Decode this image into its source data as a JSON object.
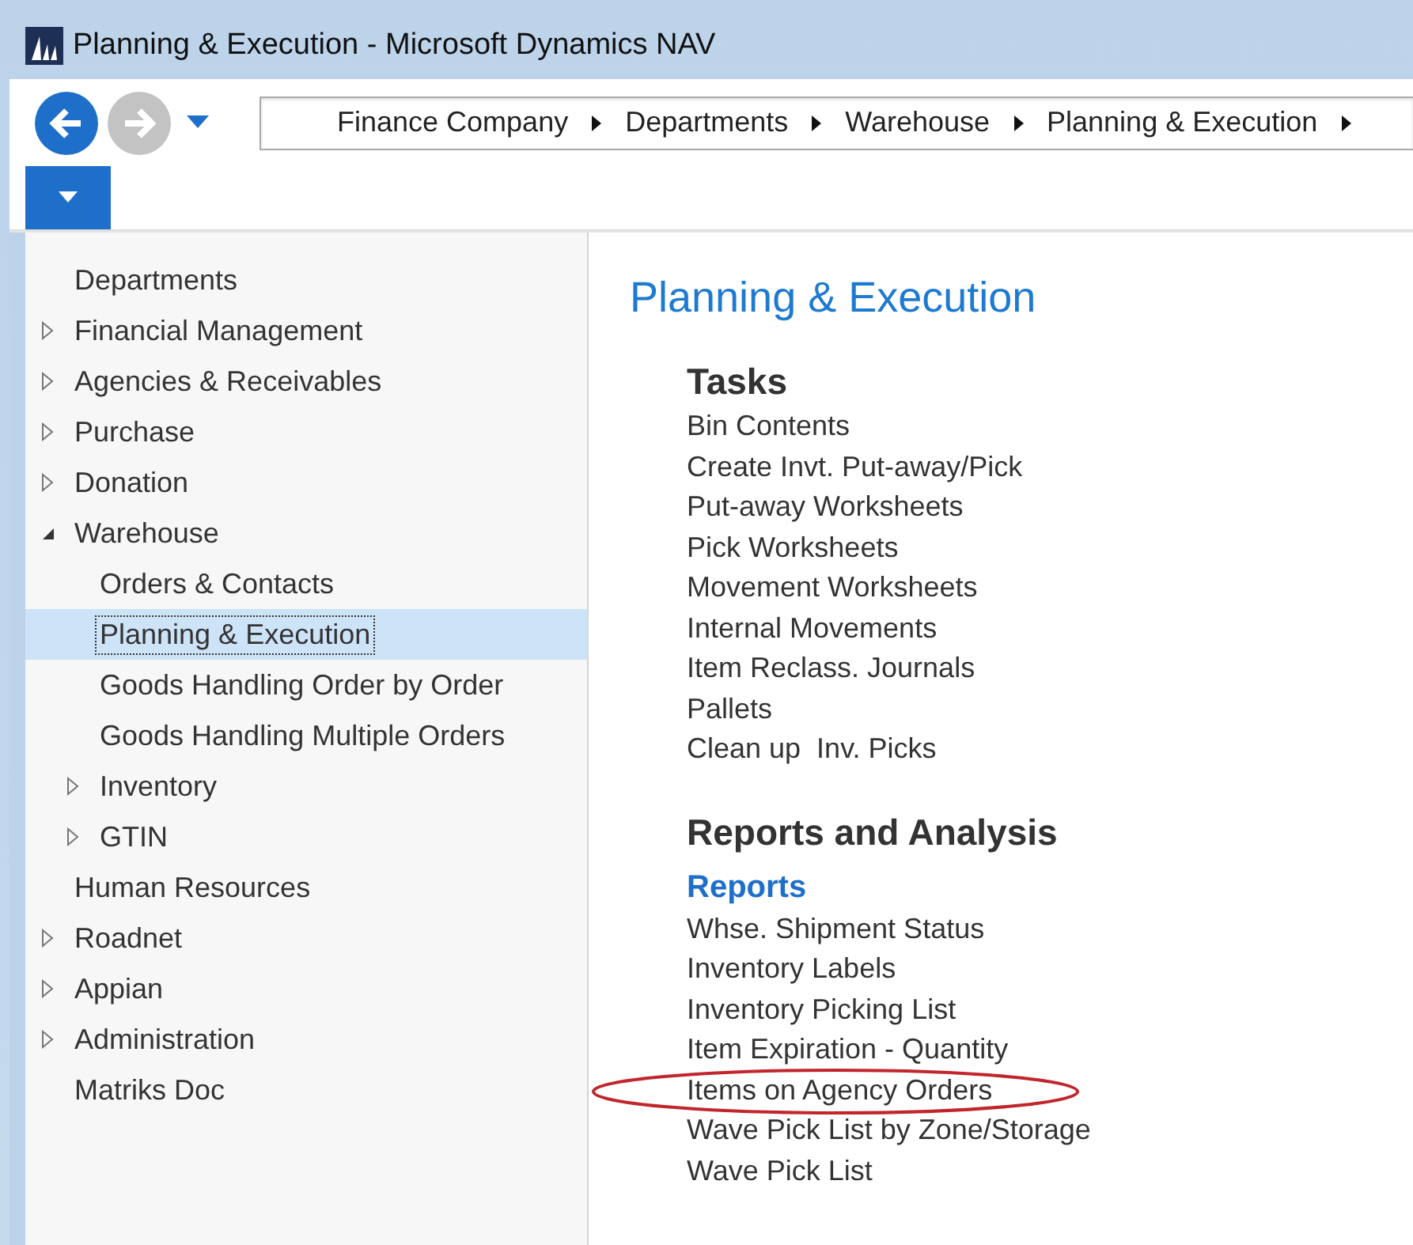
{
  "window": {
    "title": "Planning & Execution - Microsoft Dynamics NAV"
  },
  "navigation": {
    "back": {
      "disabled": false
    },
    "forward": {
      "disabled": true
    },
    "breadcrumb": [
      "Finance Company",
      "Departments",
      "Warehouse",
      "Planning & Execution"
    ]
  },
  "sidebar": {
    "items": [
      {
        "label": "Departments",
        "kind": "leaf",
        "selected": false
      },
      {
        "label": "Financial Management",
        "kind": "node",
        "expanded": false,
        "selected": false
      },
      {
        "label": "Agencies & Receivables",
        "kind": "node",
        "expanded": false,
        "selected": false
      },
      {
        "label": "Purchase",
        "kind": "node",
        "expanded": false,
        "selected": false
      },
      {
        "label": "Donation",
        "kind": "node",
        "expanded": false,
        "selected": false
      },
      {
        "label": "Warehouse",
        "kind": "node",
        "expanded": true,
        "selected": false,
        "children": [
          {
            "label": "Orders & Contacts",
            "kind": "leaf",
            "selected": false
          },
          {
            "label": "Planning & Execution",
            "kind": "leaf",
            "selected": true
          },
          {
            "label": "Goods Handling Order by Order",
            "kind": "leaf",
            "selected": false
          },
          {
            "label": "Goods Handling Multiple Orders",
            "kind": "leaf",
            "selected": false
          },
          {
            "label": "Inventory",
            "kind": "node",
            "expanded": false,
            "selected": false
          },
          {
            "label": "GTIN",
            "kind": "node",
            "expanded": false,
            "selected": false
          }
        ]
      },
      {
        "label": "Human Resources",
        "kind": "leaf",
        "selected": false
      },
      {
        "label": "Roadnet",
        "kind": "node",
        "expanded": false,
        "selected": false
      },
      {
        "label": "Appian",
        "kind": "node",
        "expanded": false,
        "selected": false
      },
      {
        "label": "Administration",
        "kind": "node",
        "expanded": false,
        "selected": false
      },
      {
        "label": "Matriks Doc",
        "kind": "leaf",
        "selected": false
      }
    ]
  },
  "content": {
    "title": "Planning & Execution",
    "sections": [
      {
        "heading": "Tasks",
        "groups": [
          {
            "items": [
              {
                "label": "Bin Contents",
                "circled": false
              },
              {
                "label": "Create Invt. Put-away/Pick",
                "circled": false
              },
              {
                "label": "Put-away Worksheets",
                "circled": false
              },
              {
                "label": "Pick Worksheets",
                "circled": false
              },
              {
                "label": "Movement Worksheets",
                "circled": false
              },
              {
                "label": "Internal Movements",
                "circled": false
              },
              {
                "label": "Item Reclass. Journals",
                "circled": false
              },
              {
                "label": "Pallets",
                "circled": false
              },
              {
                "label": "Clean up  Inv. Picks",
                "circled": false
              }
            ]
          }
        ]
      },
      {
        "heading": "Reports and Analysis",
        "groups": [
          {
            "subheading": "Reports",
            "items": [
              {
                "label": "Whse. Shipment Status",
                "circled": false
              },
              {
                "label": "Inventory Labels",
                "circled": false
              },
              {
                "label": "Inventory Picking List",
                "circled": false
              },
              {
                "label": "Item Expiration - Quantity",
                "circled": false
              },
              {
                "label": "Items on Agency Orders",
                "circled": true
              },
              {
                "label": "Wave Pick List by Zone/Storage",
                "circled": false
              },
              {
                "label": "Wave Pick List",
                "circled": false
              }
            ]
          }
        ]
      }
    ]
  }
}
